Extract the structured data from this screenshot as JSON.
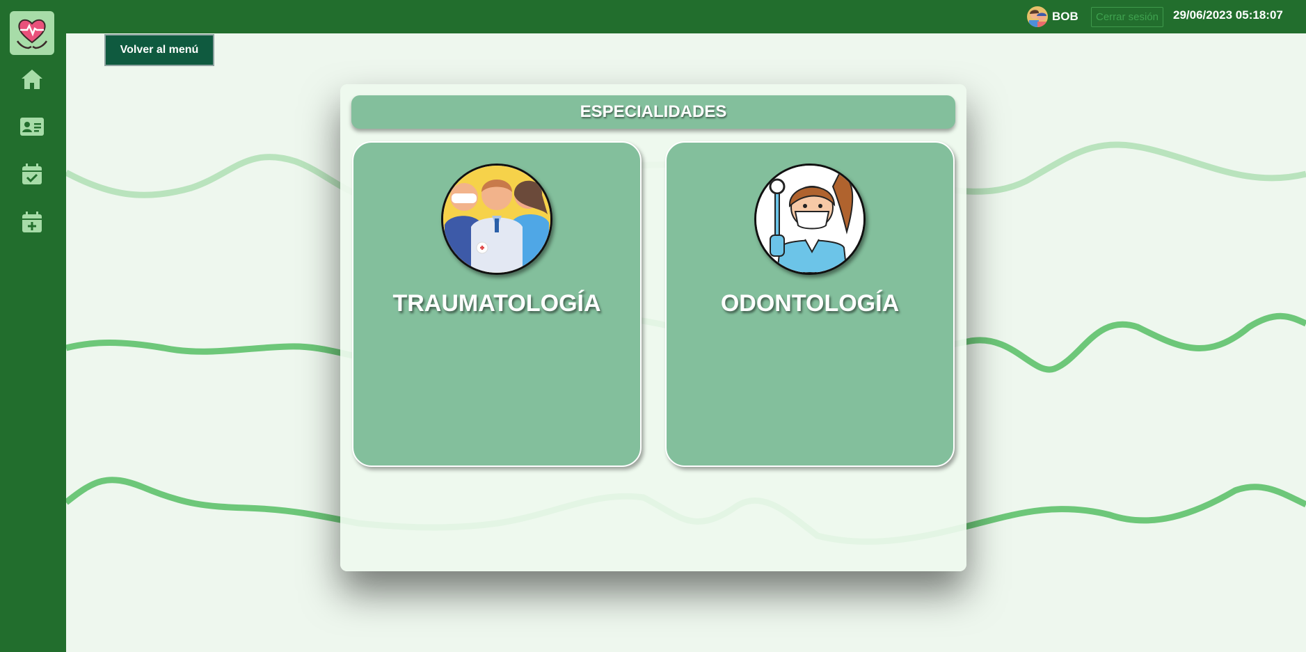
{
  "header": {
    "user_name": "BOB",
    "logout_label": "Cerrar sesión",
    "datetime": "29/06/2023 05:18:07"
  },
  "sidebar": {
    "logo_icon": "heart-hands-icon",
    "items": [
      {
        "icon": "home-icon"
      },
      {
        "icon": "id-card-icon"
      },
      {
        "icon": "calendar-check-icon"
      },
      {
        "icon": "calendar-plus-icon"
      }
    ]
  },
  "back_button": {
    "label": "Volver al menú"
  },
  "panel": {
    "title": "ESPECIALIDADES",
    "specialties": [
      {
        "name": "TRAUMATOLOGÍA",
        "icon": "medical-team-icon"
      },
      {
        "name": "ODONTOLOGÍA",
        "icon": "dentist-icon"
      }
    ]
  },
  "colors": {
    "primary": "#226e2d",
    "background": "#eef7ee",
    "card": "#83bf9c",
    "back_button": "#0f5a3f",
    "logout_text": "#3fa24f"
  }
}
